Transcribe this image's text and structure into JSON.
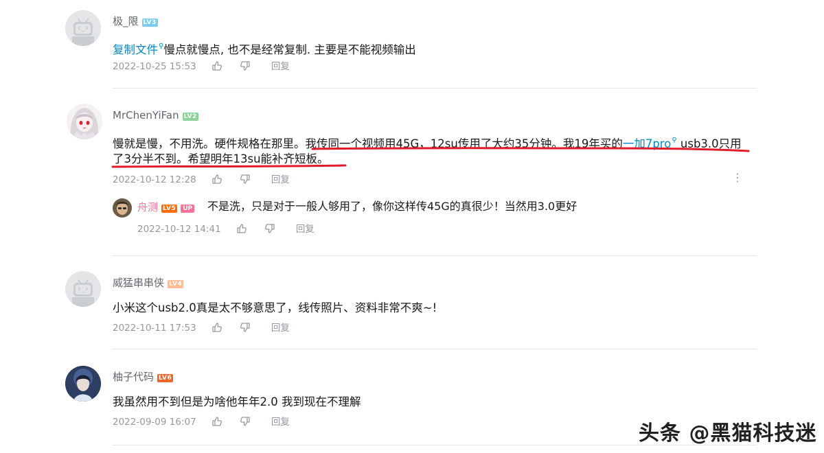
{
  "comments": [
    {
      "username": "极_限",
      "level": "LV3",
      "text_link": "复制文件",
      "text_rest": "慢点就慢点, 也不是经常复制. 主要是不能视频输出",
      "time": "2022-10-25 15:53",
      "reply_label": "回复"
    },
    {
      "username": "MrChenYiFan",
      "level": "LV2",
      "line1_a": "慢就是慢，不用洗。硬件规格在那里。",
      "line1_b": "我传同一个视频用45G，12su传用了大约35分钟。我19年买的",
      "line1_link": "一加7pro",
      "line1_c": " usb3.0只用",
      "line2": "了3分半不到。希望明年13su能补齐短板。",
      "time": "2022-10-12 12:28",
      "reply_label": "回复",
      "reply": {
        "username": "舟测",
        "level": "LV5",
        "up_label": "UP",
        "text": "不是洗，只是对于一般人够用了，像你这样传45G的真很少！当然用3.0更好",
        "time": "2022-10-12 14:41",
        "reply_label": "回复"
      }
    },
    {
      "username": "威猛串串侠",
      "level": "LV4",
      "text": "小米这个usb2.0真是太不够意思了，线传照片、资料非常不爽~!",
      "time": "2022-10-11 17:53",
      "reply_label": "回复"
    },
    {
      "username": "柚子代码",
      "level": "LV6",
      "text": "我虽然用不到但是为啥他年年2.0 我到现在不理解",
      "time": "2022-09-09 16:07",
      "reply_label": "回复"
    }
  ],
  "level_colors": {
    "LV2": "#8bd29b",
    "LV3": "#7bcdef",
    "LV4": "#feba90",
    "LV5": "#ff6c00",
    "LV6": "#ee672a"
  },
  "accent_link": "#008ac5",
  "highlight_underline": "#e21b2a",
  "watermark": "头条 @黑猫科技迷",
  "icons": [
    "like-icon",
    "dislike-icon",
    "more-icon",
    "search-icon"
  ]
}
